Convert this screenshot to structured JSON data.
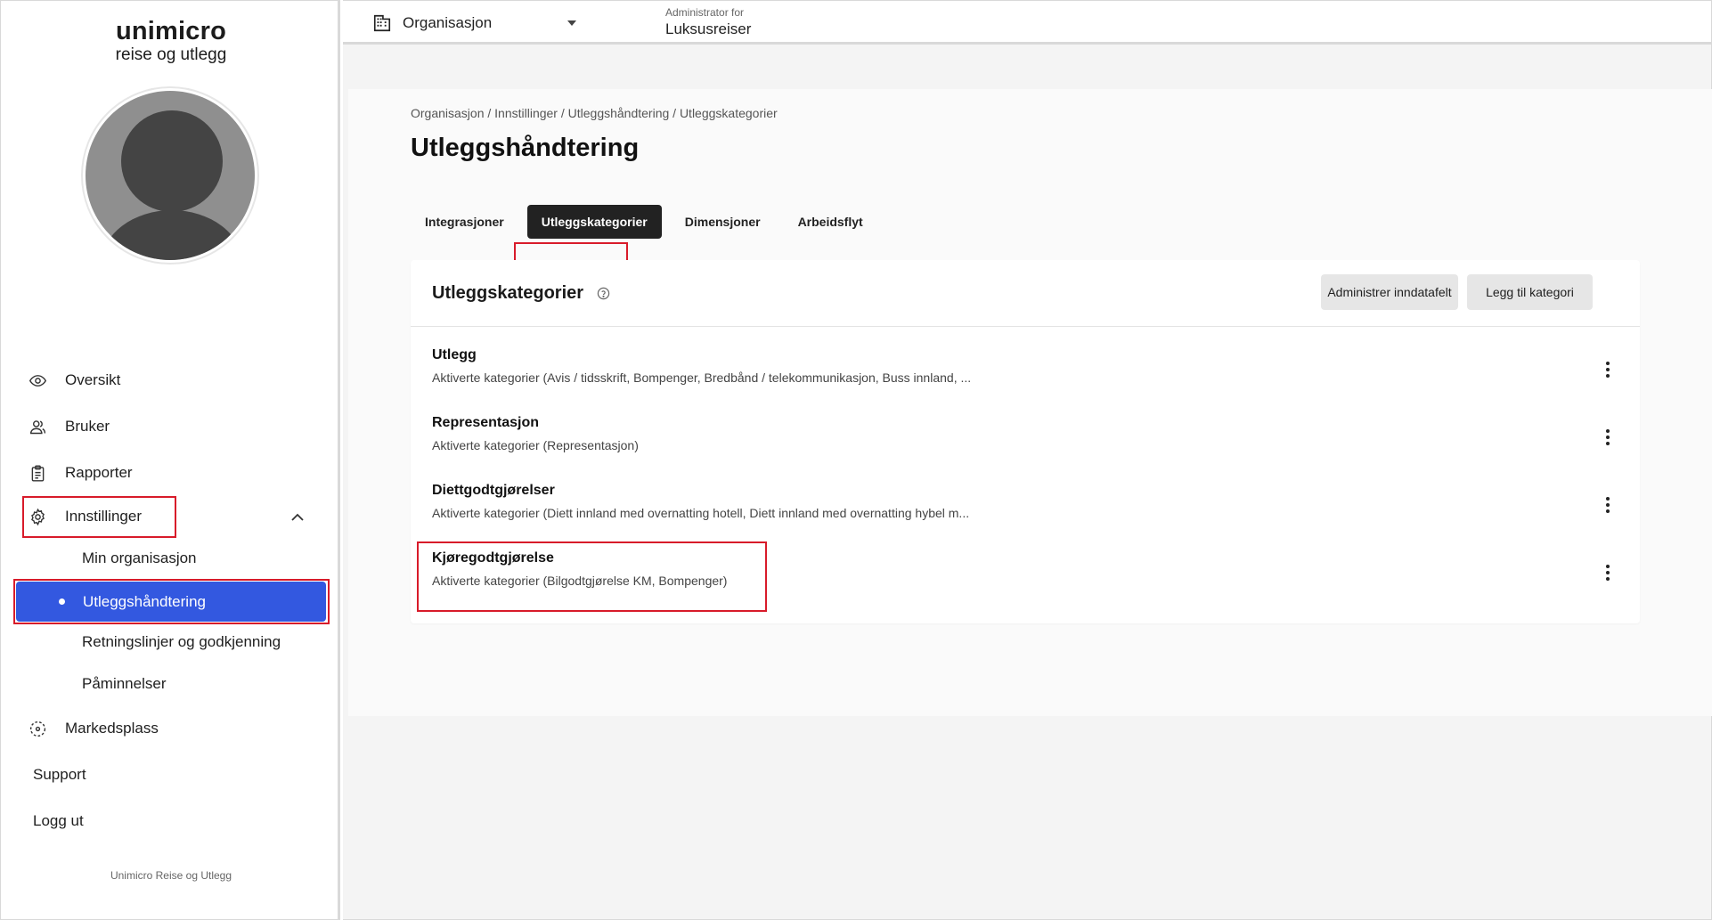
{
  "logo": {
    "line1": "unimicro",
    "line2": "reise og utlegg"
  },
  "sidebar": {
    "items": [
      {
        "label": "Oversikt",
        "icon": "eye-icon"
      },
      {
        "label": "Bruker",
        "icon": "users-icon"
      },
      {
        "label": "Rapporter",
        "icon": "clipboard-icon"
      },
      {
        "label": "Innstillinger",
        "icon": "gear-icon"
      }
    ],
    "sub_items": [
      {
        "label": "Min organisasjon"
      },
      {
        "label": "Utleggshåndtering",
        "active": true
      },
      {
        "label": "Retningslinjer og godkjenning"
      },
      {
        "label": "Påminnelser"
      }
    ],
    "marketplace": {
      "label": "Markedsplass",
      "icon": "marketplace-icon"
    },
    "support": "Support",
    "logout": "Logg ut",
    "footer": "Unimicro Reise og Utlegg"
  },
  "topbar": {
    "org_select": "Organisasjon",
    "admin_label": "Administrator for",
    "admin_value": "Luksusreiser"
  },
  "main": {
    "breadcrumb": "Organisasjon / Innstillinger / Utleggshåndtering / Utleggskategorier",
    "title": "Utleggshåndtering",
    "tabs": [
      {
        "label": "Integrasjoner"
      },
      {
        "label": "Utleggskategorier",
        "active": true
      },
      {
        "label": "Dimensjoner"
      },
      {
        "label": "Arbeidsflyt"
      }
    ],
    "card": {
      "title": "Utleggskategorier",
      "btn_admin": "Administrer inndatafelt",
      "btn_add": "Legg til kategori",
      "rows": [
        {
          "title": "Utlegg",
          "subtitle": "Aktiverte kategorier (Avis / tidsskrift, Bompenger, Bredbånd / telekommunikasjon, Buss innland, ..."
        },
        {
          "title": "Representasjon",
          "subtitle": "Aktiverte kategorier (Representasjon)"
        },
        {
          "title": "Diettgodtgjørelser",
          "subtitle": "Aktiverte kategorier (Diett innland med overnatting hotell, Diett innland med overnatting hybel m..."
        },
        {
          "title": "Kjøregodtgjørelse",
          "subtitle": "Aktiverte kategorier (Bilgodtgjørelse KM, Bompenger)"
        }
      ]
    }
  },
  "colors": {
    "accent": "#3358e0",
    "highlight": "#d81b2a",
    "tab_active": "#222222"
  }
}
